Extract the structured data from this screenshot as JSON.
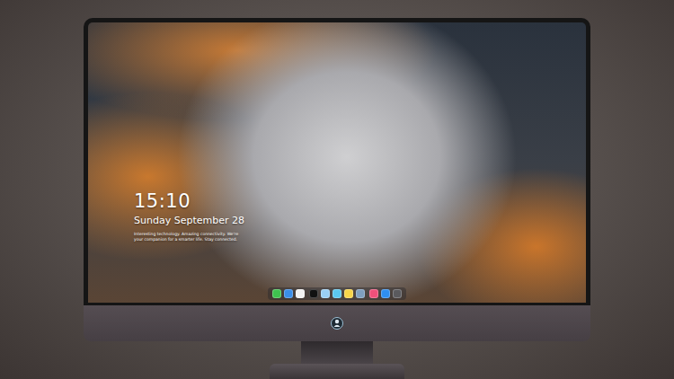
{
  "lock_screen": {
    "time": "15:10",
    "date": "Sunday September 28",
    "caption_lines": [
      "Interesting technology. Amazing connectivity. We're",
      "your companion for a smarter life. Stay connected."
    ]
  },
  "dock": {
    "groups": [
      [
        {
          "color": "#3fc24f"
        },
        {
          "color": "#3a8ee8"
        },
        {
          "color": "#f2f2f2"
        }
      ],
      [
        {
          "color": "#111111"
        },
        {
          "color": "#9ad0f5"
        },
        {
          "color": "#5bc8ef"
        },
        {
          "color": "#f7d54a"
        },
        {
          "color": "#7f9fbf"
        }
      ],
      [
        {
          "color": "#f0507a"
        },
        {
          "color": "#2f8ff0"
        },
        {
          "color": "#5a5a5e"
        }
      ]
    ]
  }
}
